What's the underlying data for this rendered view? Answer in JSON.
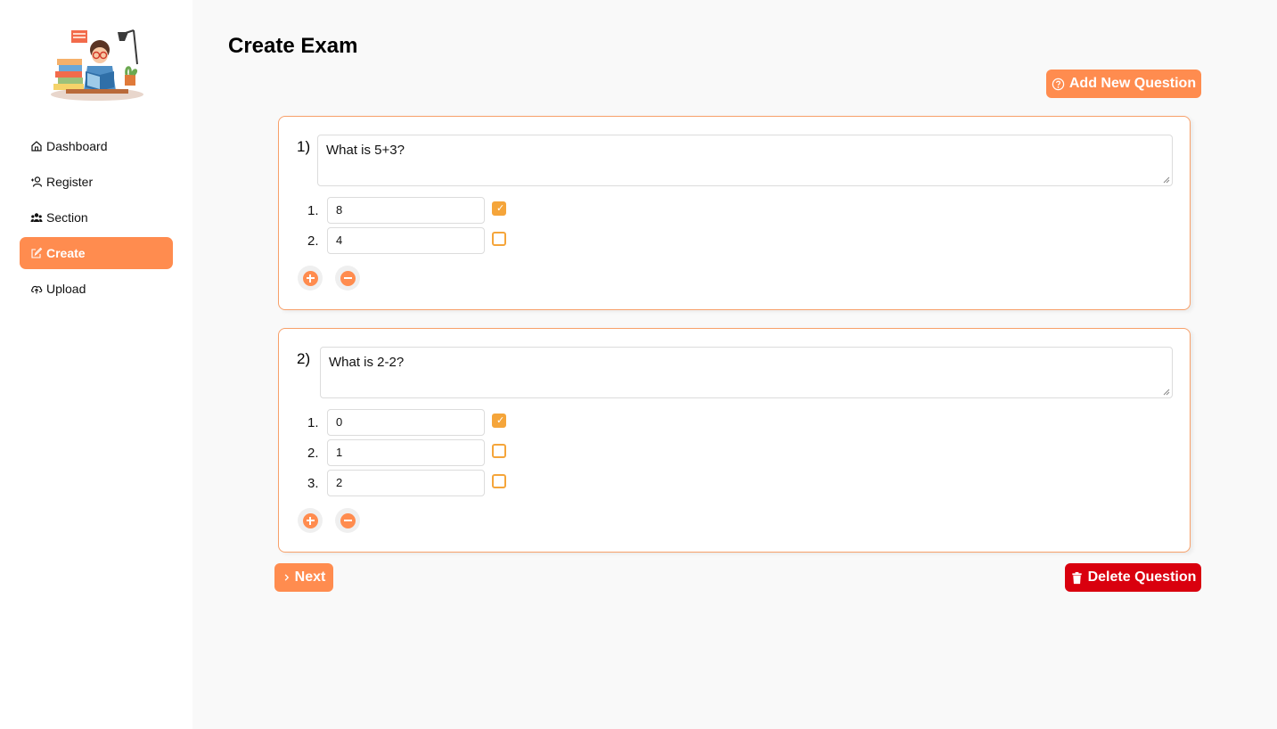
{
  "sidebar": {
    "items": [
      {
        "label": "Dashboard",
        "icon": "home-icon",
        "active": false
      },
      {
        "label": "Register",
        "icon": "user-add-icon",
        "active": false
      },
      {
        "label": "Section",
        "icon": "team-icon",
        "active": false
      },
      {
        "label": "Create",
        "icon": "edit-icon",
        "active": true
      },
      {
        "label": "Upload",
        "icon": "cloud-upload-icon",
        "active": false
      }
    ]
  },
  "page": {
    "title": "Create Exam"
  },
  "actions": {
    "add_question_label": "Add New Question",
    "next_label": "Next",
    "delete_question_label": "Delete Question"
  },
  "questions": [
    {
      "number": "1)",
      "text": "What is 5+3?",
      "answers": [
        {
          "number": "1.",
          "value": "8",
          "correct": true
        },
        {
          "number": "2.",
          "value": "4",
          "correct": false
        }
      ]
    },
    {
      "number": "2)",
      "text": "What is 2-2?",
      "answers": [
        {
          "number": "1.",
          "value": "0",
          "correct": true
        },
        {
          "number": "2.",
          "value": "1",
          "correct": false
        },
        {
          "number": "3.",
          "value": "2",
          "correct": false
        }
      ]
    }
  ],
  "colors": {
    "accent": "#ff8c4f",
    "checkbox": "#f5a53a",
    "danger": "#d9000e",
    "card_border": "#f7a06a"
  }
}
